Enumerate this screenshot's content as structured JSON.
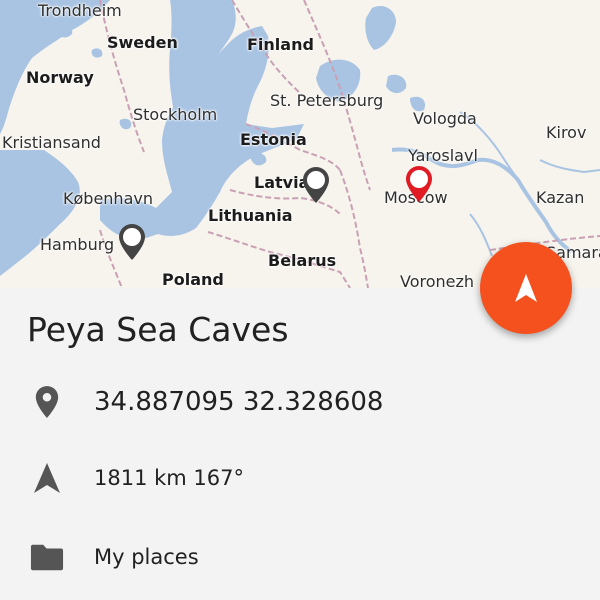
{
  "map": {
    "countries": [
      "Sweden",
      "Finland",
      "Norway",
      "Estonia",
      "Latvia",
      "Lithuania",
      "Belarus",
      "Poland"
    ],
    "cities": [
      "Trondheim",
      "Stockholm",
      "St. Petersburg",
      "Vologda",
      "Kirov",
      "Kristiansand",
      "Yaroslavl",
      "København",
      "Moscow",
      "Kazan",
      "Hamburg",
      "Samara",
      "Voronezh"
    ],
    "colors": {
      "water": "#a9c4e3",
      "land": "#f7f4ee",
      "border": "#c9a0b4",
      "selected_pin": "#e01b24",
      "pin": "#444444"
    }
  },
  "place": {
    "title": "Peya Sea Caves",
    "coordinates": "34.887095 32.328608",
    "distance": "1811 km 167°",
    "folder": "My places"
  },
  "icons": {
    "coordinates": "location-pin-icon",
    "distance": "navigation-arrow-icon",
    "folder": "folder-icon",
    "fab": "navigate-icon"
  },
  "colors": {
    "accent": "#f4511e",
    "text": "#212121",
    "panel_bg": "#f3f3f3",
    "icon": "#555555"
  }
}
